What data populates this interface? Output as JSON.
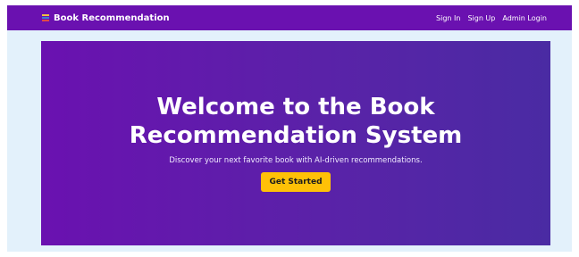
{
  "navbar": {
    "brand_icon": "book-icon",
    "brand_label": "Book Recommendation",
    "links": [
      "Sign In",
      "Sign Up",
      "Admin Login"
    ],
    "background": "#6a11b0"
  },
  "hero": {
    "title": "Welcome to the Book Recommendation System",
    "subtitle": "Discover your next favorite book with AI-driven recommendations.",
    "cta_label": "Get Started",
    "cta_color": "#ffc107",
    "gradient": [
      "#6a11b0",
      "#4a2ba3"
    ]
  },
  "page": {
    "background": "#e3f1fb"
  }
}
